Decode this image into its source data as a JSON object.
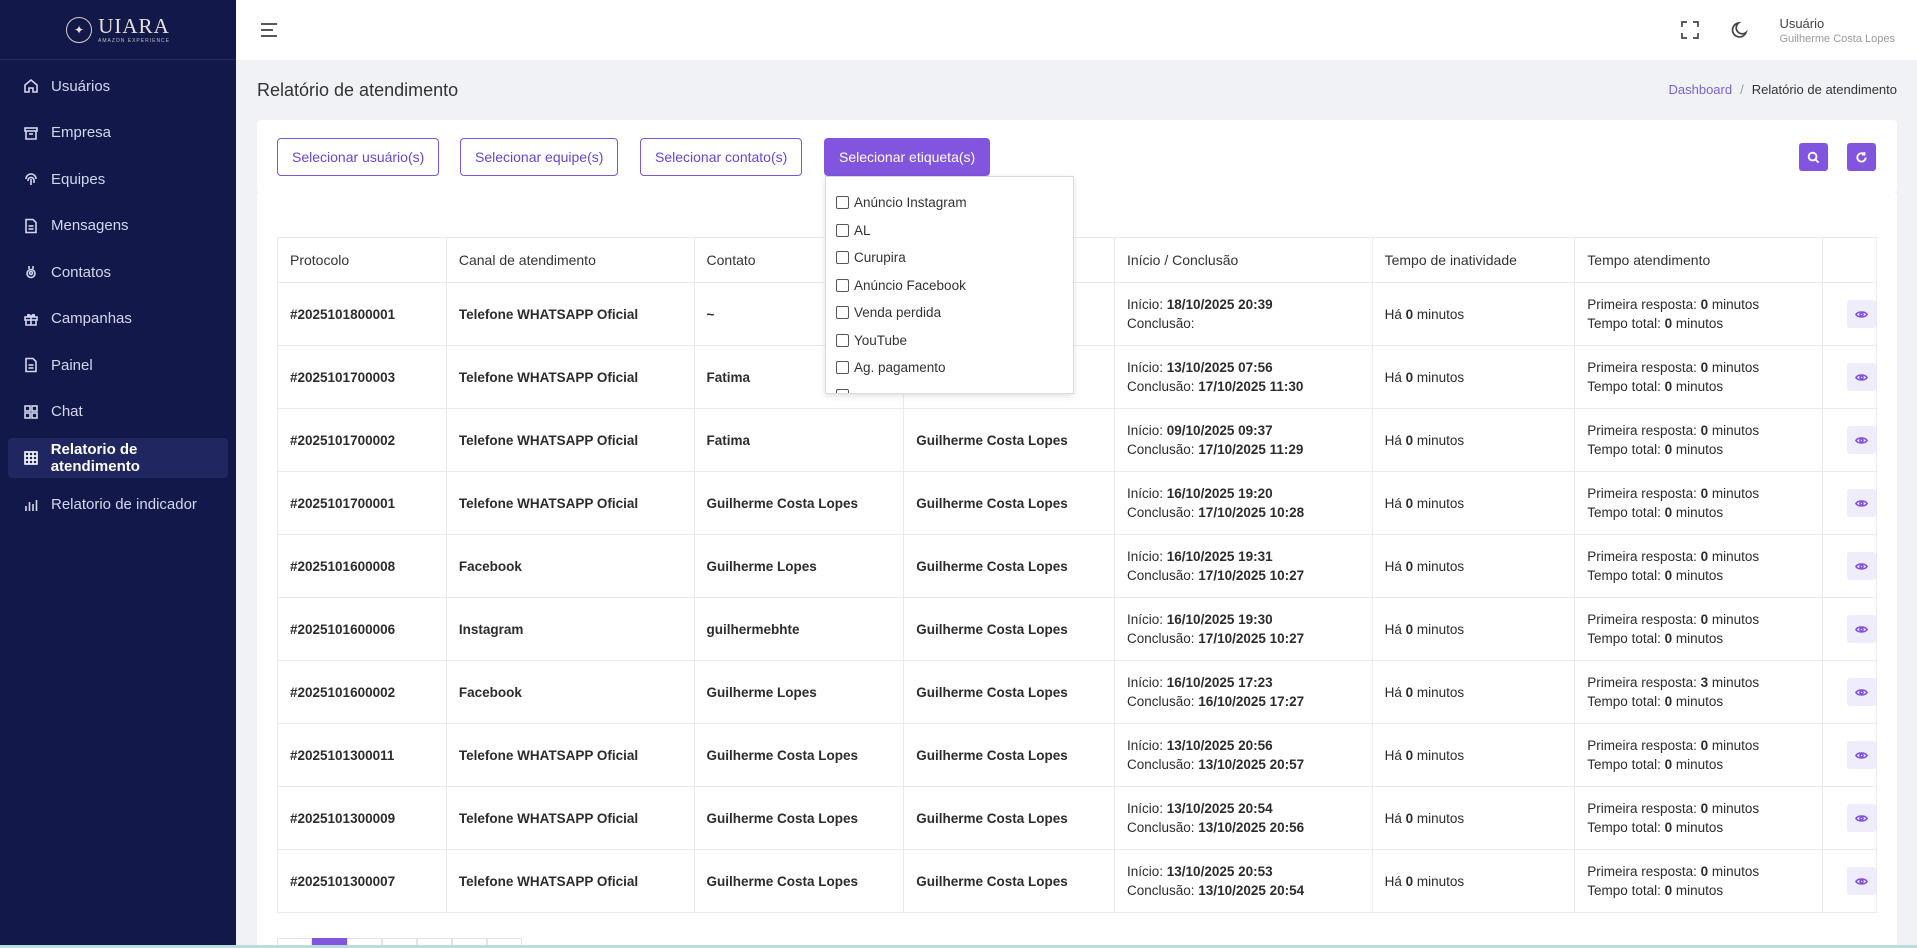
{
  "sidebar": {
    "brand_name": "UIARA",
    "brand_sub": "AMAZON EXPERIENCE",
    "items": [
      {
        "label": "Usuários",
        "icon": "home-icon"
      },
      {
        "label": "Empresa",
        "icon": "archive-icon"
      },
      {
        "label": "Equipes",
        "icon": "fingerprint-icon"
      },
      {
        "label": "Mensagens",
        "icon": "document-icon"
      },
      {
        "label": "Contatos",
        "icon": "contact-icon"
      },
      {
        "label": "Campanhas",
        "icon": "gift-icon"
      },
      {
        "label": "Painel",
        "icon": "document-icon"
      },
      {
        "label": "Chat",
        "icon": "grid-icon"
      },
      {
        "label": "Relatorio de atendimento",
        "icon": "table-icon",
        "active": true
      },
      {
        "label": "Relatorio de indicador",
        "icon": "bar-chart-icon"
      }
    ]
  },
  "topbar": {
    "user_role": "Usuário",
    "user_name": "Guilherme Costa Lopes"
  },
  "page": {
    "title": "Relatório de atendimento",
    "breadcrumb_home": "Dashboard",
    "breadcrumb_sep": "/",
    "breadcrumb_current": "Relatório de atendimento"
  },
  "filters": {
    "users_label": "Selecionar usuário(s)",
    "teams_label": "Selecionar equipe(s)",
    "contacts_label": "Selecionar contato(s)",
    "tags_label": "Selecionar etiqueta(s)"
  },
  "dropdown": {
    "options": [
      "Anúncio Instagram",
      "AL",
      "Curupira",
      "Anúncio Facebook",
      "Venda perdida",
      "YouTube",
      "Ag. pagamento"
    ]
  },
  "table": {
    "headers": [
      "Protocolo",
      "Canal de atendimento",
      "Contato",
      "",
      "Início / Conclusão",
      "Tempo de inatividade",
      "Tempo atendimento",
      ""
    ],
    "labels": {
      "start": "Início:",
      "end": "Conclusão:",
      "inactive_prefix": "Há",
      "minutes": "minutos",
      "first_response": "Primeira resposta:",
      "total_time": "Tempo total:"
    },
    "rows": [
      {
        "protocol": "#2025101800001",
        "channel": "Telefone WHATSAPP Oficial",
        "contact": "~",
        "agent": "",
        "start": "18/10/2025 20:39",
        "end": "",
        "inactive": "0",
        "first": "0",
        "total": "0"
      },
      {
        "protocol": "#2025101700003",
        "channel": "Telefone WHATSAPP Oficial",
        "contact": "Fatima",
        "agent": "",
        "start": "13/10/2025 07:56",
        "end": "17/10/2025 11:30",
        "inactive": "0",
        "first": "0",
        "total": "0"
      },
      {
        "protocol": "#2025101700002",
        "channel": "Telefone WHATSAPP Oficial",
        "contact": "Fatima",
        "agent": "Guilherme Costa Lopes",
        "start": "09/10/2025 09:37",
        "end": "17/10/2025 11:29",
        "inactive": "0",
        "first": "0",
        "total": "0"
      },
      {
        "protocol": "#2025101700001",
        "channel": "Telefone WHATSAPP Oficial",
        "contact": "Guilherme Costa Lopes",
        "agent": "Guilherme Costa Lopes",
        "start": "16/10/2025 19:20",
        "end": "17/10/2025 10:28",
        "inactive": "0",
        "first": "0",
        "total": "0"
      },
      {
        "protocol": "#2025101600008",
        "channel": "Facebook",
        "contact": "Guilherme Lopes",
        "agent": "Guilherme Costa Lopes",
        "start": "16/10/2025 19:31",
        "end": "17/10/2025 10:27",
        "inactive": "0",
        "first": "0",
        "total": "0"
      },
      {
        "protocol": "#2025101600006",
        "channel": "Instagram",
        "contact": "guilhermebhte",
        "agent": "Guilherme Costa Lopes",
        "start": "16/10/2025 19:30",
        "end": "17/10/2025 10:27",
        "inactive": "0",
        "first": "0",
        "total": "0"
      },
      {
        "protocol": "#2025101600002",
        "channel": "Facebook",
        "contact": "Guilherme Lopes",
        "agent": "Guilherme Costa Lopes",
        "start": "16/10/2025 17:23",
        "end": "16/10/2025 17:27",
        "inactive": "0",
        "first": "3",
        "total": "0"
      },
      {
        "protocol": "#2025101300011",
        "channel": "Telefone WHATSAPP Oficial",
        "contact": "Guilherme Costa Lopes",
        "agent": "Guilherme Costa Lopes",
        "start": "13/10/2025 20:56",
        "end": "13/10/2025 20:57",
        "inactive": "0",
        "first": "0",
        "total": "0"
      },
      {
        "protocol": "#2025101300009",
        "channel": "Telefone WHATSAPP Oficial",
        "contact": "Guilherme Costa Lopes",
        "agent": "Guilherme Costa Lopes",
        "start": "13/10/2025 20:54",
        "end": "13/10/2025 20:56",
        "inactive": "0",
        "first": "0",
        "total": "0"
      },
      {
        "protocol": "#2025101300007",
        "channel": "Telefone WHATSAPP Oficial",
        "contact": "Guilherme Costa Lopes",
        "agent": "Guilherme Costa Lopes",
        "start": "13/10/2025 20:53",
        "end": "13/10/2025 20:54",
        "inactive": "0",
        "first": "0",
        "total": "0"
      }
    ]
  },
  "colors": {
    "sidebar_bg": "#12184a",
    "accent": "#8255de",
    "page_bg": "#f1f2f6"
  }
}
